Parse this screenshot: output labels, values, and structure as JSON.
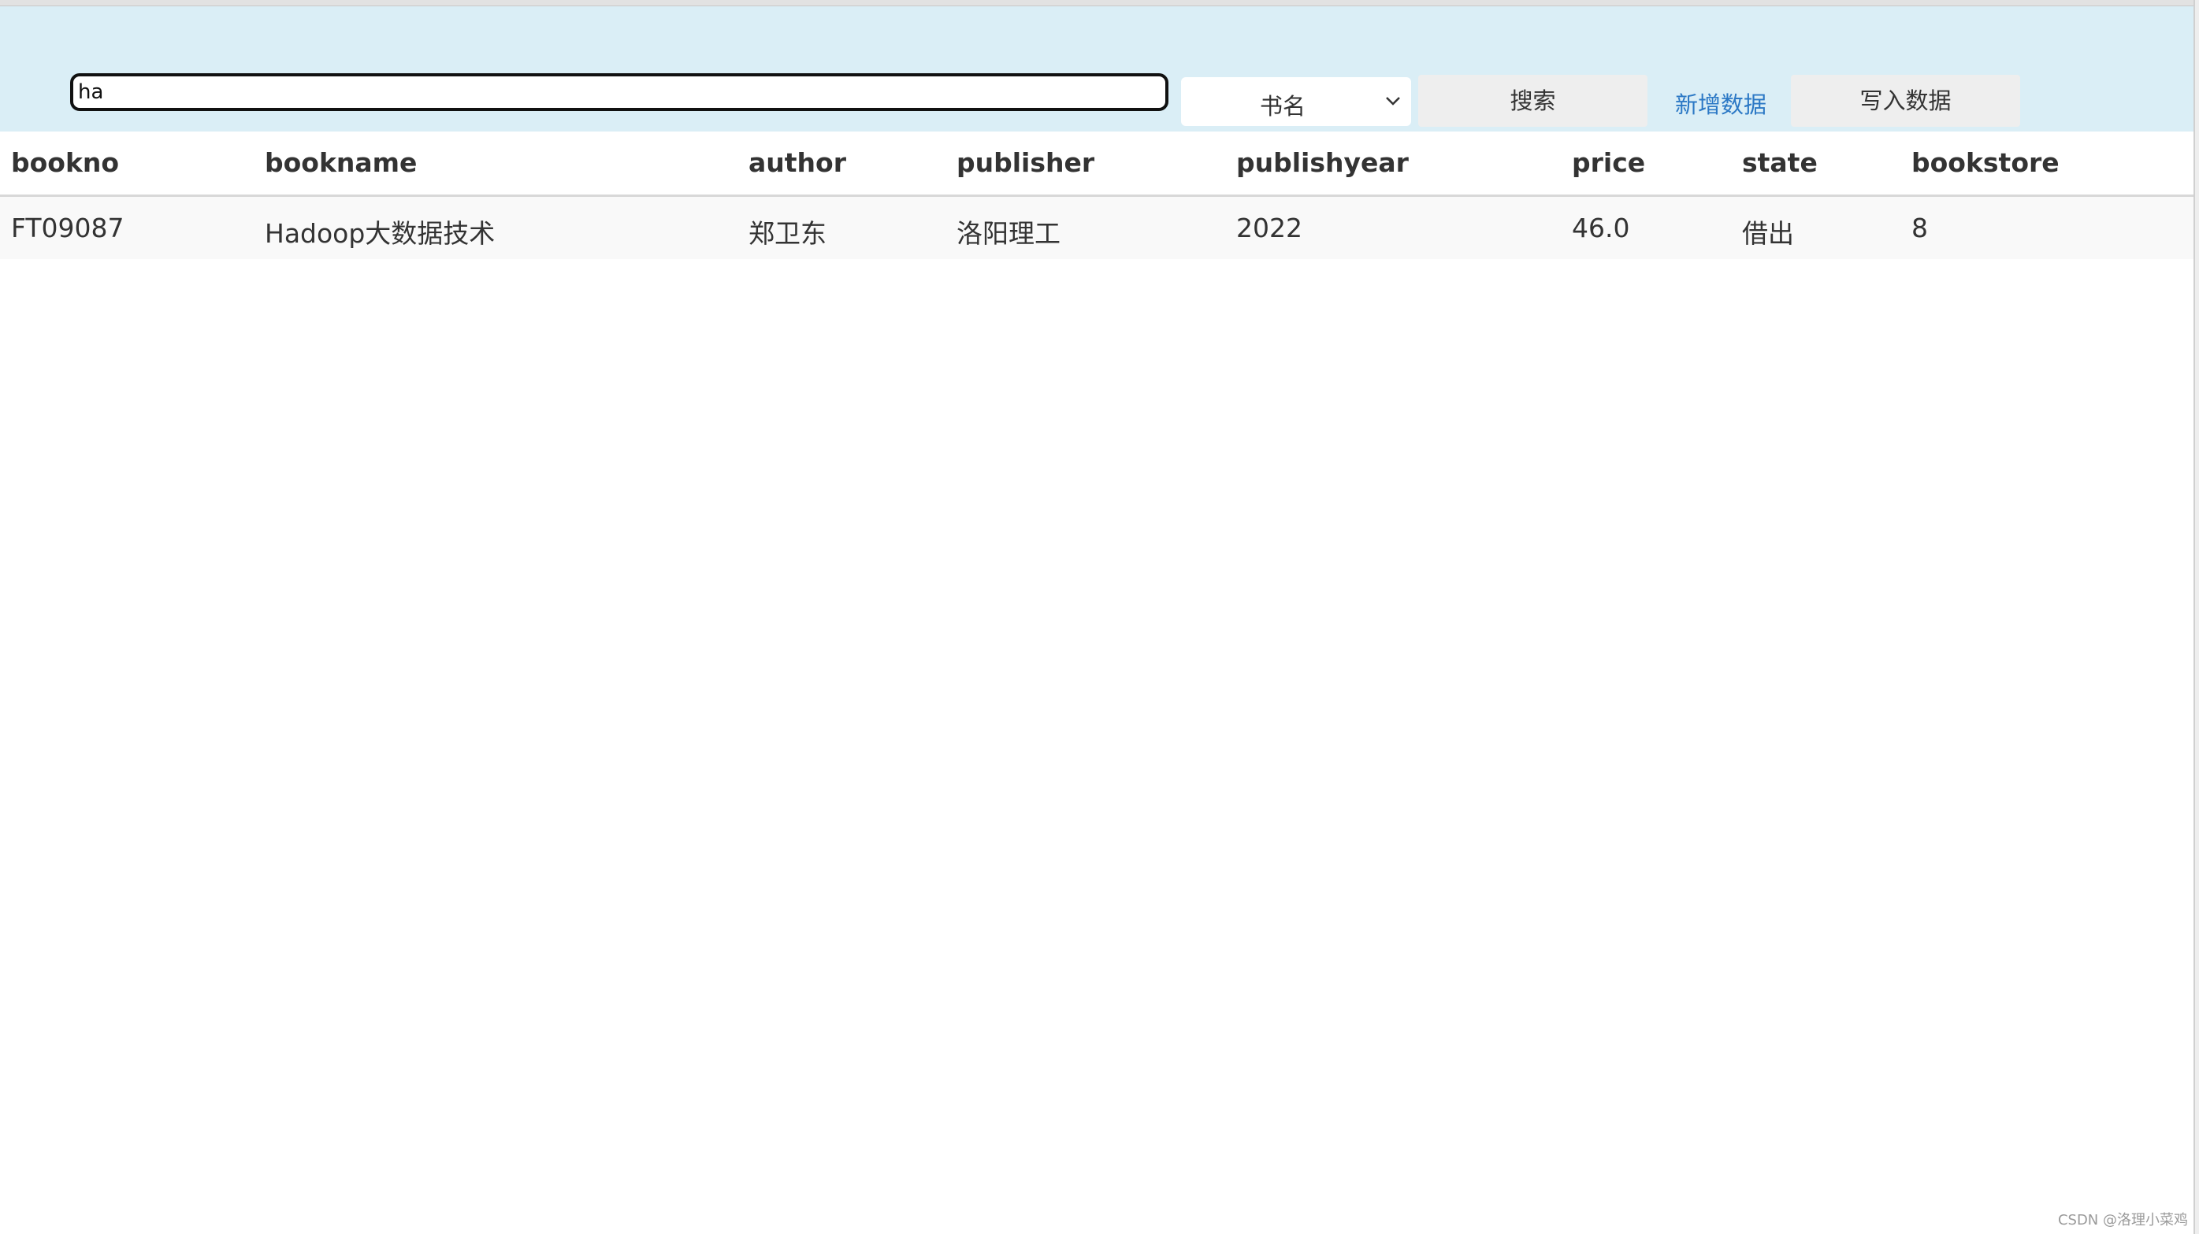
{
  "toolbar": {
    "search_value": "ha",
    "field_select_value": "书名",
    "search_button": "搜索",
    "add_link": "新增数据",
    "write_button": "写入数据"
  },
  "table": {
    "columns": [
      "bookno",
      "bookname",
      "author",
      "publisher",
      "publishyear",
      "price",
      "state",
      "bookstore"
    ],
    "rows": [
      [
        "FT09087",
        "Hadoop大数据技术",
        "郑卫东",
        "洛阳理工",
        "2022",
        "46.0",
        "借出",
        "8"
      ]
    ]
  },
  "watermark": "CSDN @洛理小菜鸡",
  "colors": {
    "toolbar_bg": "#daeef6",
    "link": "#2b78c5",
    "button_bg": "#eeeeee"
  }
}
